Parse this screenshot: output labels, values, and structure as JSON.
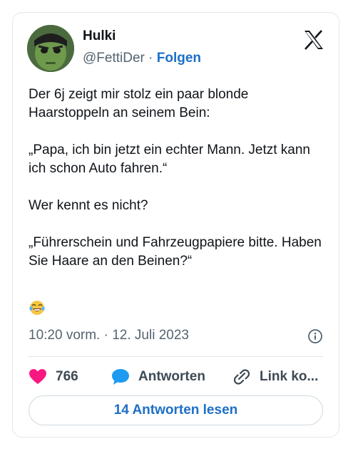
{
  "author": {
    "name": "Hulki",
    "handle": "@FettiDer",
    "separator": " · ",
    "follow_label": "Folgen"
  },
  "tweet": {
    "text": "Der 6j zeigt mir stolz ein paar blonde Haarstoppeln an seinem Bein:\n\n„Papa, ich bin jetzt ein echter Mann. Jetzt kann ich schon Auto fahren.“\n\nWer kennt es nicht?\n\n„Führerschein und Fahrzeugpapiere bitte. Haben Sie Haare an den Beinen?“",
    "emoji": "laughing-tears",
    "timestamp": "10:20 vorm. · 12. Juli 2023"
  },
  "actions": {
    "like_count": "766",
    "reply_label": "Antworten",
    "link_label": "Link ko..."
  },
  "read_replies_label": "14 Antworten lesen",
  "icons": {
    "brand": "x-logo-icon",
    "info": "info-icon",
    "like": "heart-icon",
    "reply": "speech-bubble-icon",
    "link": "link-icon",
    "emoji": "laughing-tears-emoji"
  },
  "colors": {
    "accent": "#1d6fc7",
    "like": "#f91880",
    "reply": "#1d9bf0",
    "muted": "#536471"
  }
}
